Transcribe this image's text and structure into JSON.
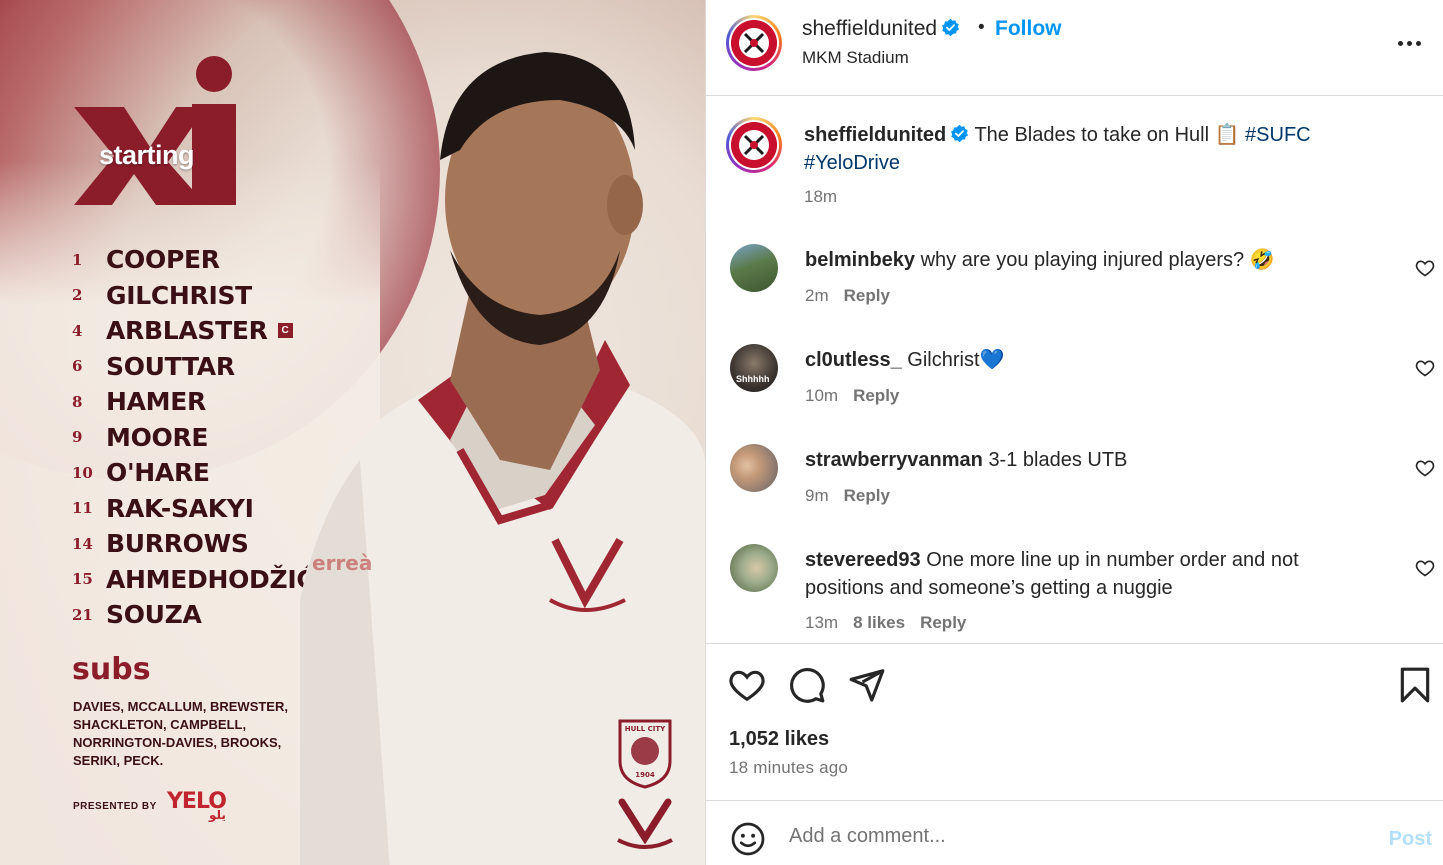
{
  "graphic": {
    "xi_word": "starting",
    "lineup": [
      {
        "num": "1",
        "name": "COOPER",
        "captain": false
      },
      {
        "num": "2",
        "name": "GILCHRIST",
        "captain": false
      },
      {
        "num": "4",
        "name": "ARBLASTER",
        "captain": true
      },
      {
        "num": "6",
        "name": "SOUTTAR",
        "captain": false
      },
      {
        "num": "8",
        "name": "HAMER",
        "captain": false
      },
      {
        "num": "9",
        "name": "MOORE",
        "captain": false
      },
      {
        "num": "10",
        "name": "O'HARE",
        "captain": false
      },
      {
        "num": "11",
        "name": "RAK-SAKYI",
        "captain": false
      },
      {
        "num": "14",
        "name": "BURROWS",
        "captain": false
      },
      {
        "num": "15",
        "name": "AHMEDHODŽIĆ",
        "captain": false
      },
      {
        "num": "21",
        "name": "SOUZA",
        "captain": false
      }
    ],
    "captain_mark": "C",
    "subs_title": "subs",
    "subs_list": "DAVIES, MCCALLUM, BREWSTER, SHACKLETON, CAMPBELL, NORRINGTON-DAVIES, BROOKS, SERIKI, PECK.",
    "presented_by": "PRESENTED BY",
    "sponsor": "YELO",
    "sponsor_arabic": "يلو",
    "hull_badge_text": "HULL CITY",
    "hull_badge_year": "1904"
  },
  "header": {
    "username": "sheffieldunited",
    "follow_label": "Follow",
    "separator": "•",
    "location": "MKM Stadium"
  },
  "caption": {
    "username": "sheffieldunited",
    "text": "The Blades to take on Hull 📋",
    "hashtag1": "#SUFC",
    "hashtag2": "#YeloDrive",
    "time": "18m"
  },
  "comments": [
    {
      "username": "belminbeky",
      "text": "why are you playing injured players? 🤣",
      "time": "2m",
      "likes": "",
      "reply": "Reply"
    },
    {
      "username": "cl0utless_",
      "text": "Gilchrist💙",
      "time": "10m",
      "likes": "",
      "reply": "Reply",
      "avatar_text": "Shhhhh"
    },
    {
      "username": "strawberryvanman",
      "text": "3-1 blades UTB",
      "time": "9m",
      "likes": "",
      "reply": "Reply"
    },
    {
      "username": "stevereed93",
      "text": "One more line up in number order and not positions and someone’s getting a nuggie",
      "time": "13m",
      "likes": "8 likes",
      "reply": "Reply"
    }
  ],
  "actions": {
    "likes": "1,052 likes",
    "time_ago": "18 minutes ago"
  },
  "add_comment": {
    "placeholder": "Add a comment...",
    "post_label": "Post"
  },
  "colors": {
    "brand_red": "#c8102e",
    "link_blue": "#0095f6",
    "hashtag": "#00376b",
    "maroon": "#8b1c2a"
  }
}
